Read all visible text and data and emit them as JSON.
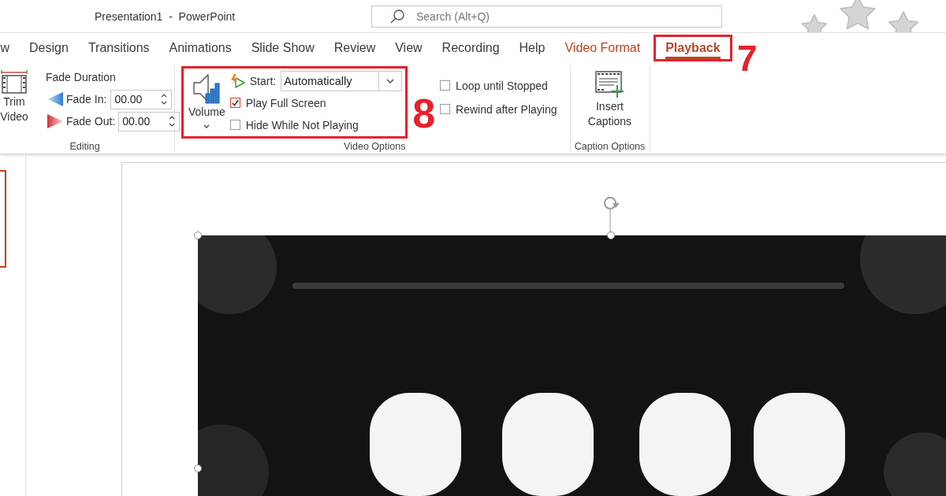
{
  "window": {
    "title": "Presentation1  -  PowerPoint"
  },
  "search": {
    "placeholder": "Search (Alt+Q)"
  },
  "tabs": [
    {
      "label": "w",
      "selected": false,
      "kind": "standard"
    },
    {
      "label": "Design",
      "selected": false,
      "kind": "standard"
    },
    {
      "label": "Transitions",
      "selected": false,
      "kind": "standard"
    },
    {
      "label": "Animations",
      "selected": false,
      "kind": "standard"
    },
    {
      "label": "Slide Show",
      "selected": false,
      "kind": "standard"
    },
    {
      "label": "Review",
      "selected": false,
      "kind": "standard"
    },
    {
      "label": "View",
      "selected": false,
      "kind": "standard"
    },
    {
      "label": "Recording",
      "selected": false,
      "kind": "standard"
    },
    {
      "label": "Help",
      "selected": false,
      "kind": "standard"
    },
    {
      "label": "Video Format",
      "selected": false,
      "kind": "contextual"
    },
    {
      "label": "Playback",
      "selected": true,
      "kind": "contextual",
      "annotation": "7"
    }
  ],
  "ribbon": {
    "groups": [
      {
        "kind": "editing",
        "label": "Editing",
        "trim_button": "Trim Video",
        "fade_heading": "Fade Duration",
        "fade_in": {
          "label": "Fade In:",
          "value": "00.00"
        },
        "fade_out": {
          "label": "Fade Out:",
          "value": "00.00"
        }
      },
      {
        "kind": "video_options",
        "label": "Video Options",
        "annotation": "8",
        "volume_button": "Volume",
        "start": {
          "label": "Start:",
          "value": "Automatically"
        },
        "options": [
          {
            "label": "Play Full Screen",
            "checked": true
          },
          {
            "label": "Hide While Not Playing",
            "checked": false
          }
        ],
        "more_options": [
          {
            "label": "Loop until Stopped",
            "checked": false
          },
          {
            "label": "Rewind after Playing",
            "checked": false
          }
        ]
      },
      {
        "kind": "captions",
        "label": "Caption Options",
        "insert_button": "Insert Captions"
      }
    ]
  },
  "slides_pane": {
    "thumbnails": [
      {
        "selected": true
      }
    ]
  },
  "slide": {
    "video": {
      "kind": "picture",
      "selected": true
    }
  }
}
